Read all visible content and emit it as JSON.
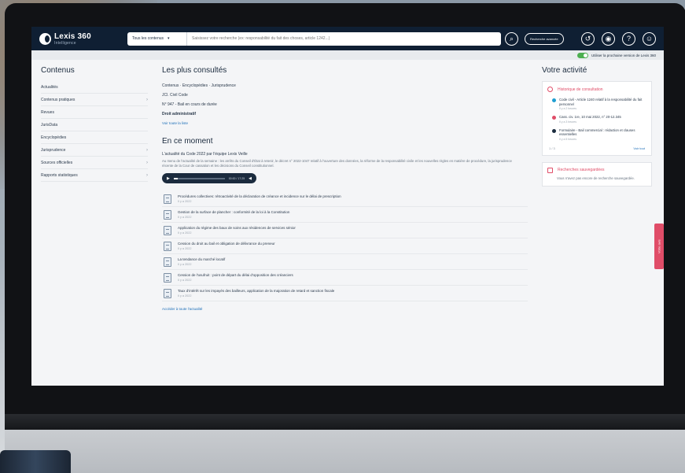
{
  "topbar": {
    "logo_text": "Lexis 360",
    "logo_sub": "Intelligence",
    "search_scope": "Tous les contenus",
    "search_placeholder": "Saisissez votre recherche (ex: responsabilité du fait des choses, article 1242...)",
    "advanced_search_label": "Recherche avancée"
  },
  "toggle": {
    "label": "Utiliser la prochaine version de Lexis 360"
  },
  "sidebar": {
    "title": "Contenus",
    "items": [
      {
        "label": "Actualités",
        "has_children": false
      },
      {
        "label": "Contenus pratiques",
        "has_children": true
      },
      {
        "label": "Revues",
        "has_children": false
      },
      {
        "label": "JurisData",
        "has_children": false
      },
      {
        "label": "Encyclopédies",
        "has_children": false
      },
      {
        "label": "Jurisprudence",
        "has_children": true
      },
      {
        "label": "Sources officielles",
        "has_children": true
      },
      {
        "label": "Rapports statistiques",
        "has_children": true
      }
    ]
  },
  "most_viewed": {
    "title": "Les plus consultés",
    "items": [
      "Contenus · Encyclopédies · Jurisprudence",
      "JCl. Civil Code",
      "N° 947 - Bail en cours de durée",
      "Droit administratif"
    ],
    "see_all": "Voir toute la liste"
  },
  "now": {
    "title": "En ce moment",
    "podcast_title": "L'actualité du Code 2022 par l'équipe Lexis Veille",
    "podcast_desc": "Au menu de l'actualité de la semaine : les arrêts du Conseil d'État à retenir, le décret n° 2022-1047 relatif à l'ouverture des données, la réforme de la responsabilité civile et les nouvelles règles en matière de procédure, la jurisprudence récente de la Cour de cassation et les décisions du Conseil constitutionnel.",
    "player_time": "00:00 / 17:25",
    "news": [
      {
        "title": "Procédures collectives: rétroactivité de la déclaration de créance et incidence sur le délai de prescription",
        "date": "Il y a 2022"
      },
      {
        "title": "Gestion de la surface de plancher : conformité de la loi à la Constitution",
        "date": "Il y a 2022"
      },
      {
        "title": "Application du régime des baux de soins aux résidences de services sénior",
        "date": "Il y a 2022"
      },
      {
        "title": "Cession du droit au bail et obligation de délivrance du preneur",
        "date": "Il y a 2022"
      },
      {
        "title": "La tendance du marché locatif",
        "date": "Il y a 2022"
      },
      {
        "title": "Cession de l'usufruit : point de départ du délai d'opposition des créanciers",
        "date": "Il y a 2022"
      },
      {
        "title": "Taux d'intérêt sur les impayés des bailleurs, application de la majoration de retard et sanction fiscale",
        "date": "Il y a 2022"
      }
    ],
    "see_more": "Accéder à toute l'actualité"
  },
  "activity": {
    "title": "Votre activité",
    "history_title": "Historique de consultation",
    "history": [
      {
        "title": "Code civil - Article 1240 relatif à la responsabilité du fait personnel",
        "date": "Il y a 2 heures",
        "color": "#1f9ed1"
      },
      {
        "title": "Cass. civ. 1re, 10 mai 2022, n° 20-12.345",
        "date": "Il y a 3 heures",
        "color": "#e04d68"
      },
      {
        "title": "Formulaire - Bail commercial : rédaction et clauses essentielles",
        "date": "Il y a 5 heures",
        "color": "#1b2b3e"
      }
    ],
    "pager": "1 / 3",
    "see_all": "Voir tout",
    "saved_title": "Recherches sauvegardées",
    "saved_desc": "Vous n'avez pas encore de recherche sauvegardée."
  },
  "feedback_label": "Votre avis",
  "colors": {
    "topbar": "#0f1f33",
    "accent": "#e04d68",
    "toggle": "#4caf50",
    "link": "#1d6fb8"
  }
}
